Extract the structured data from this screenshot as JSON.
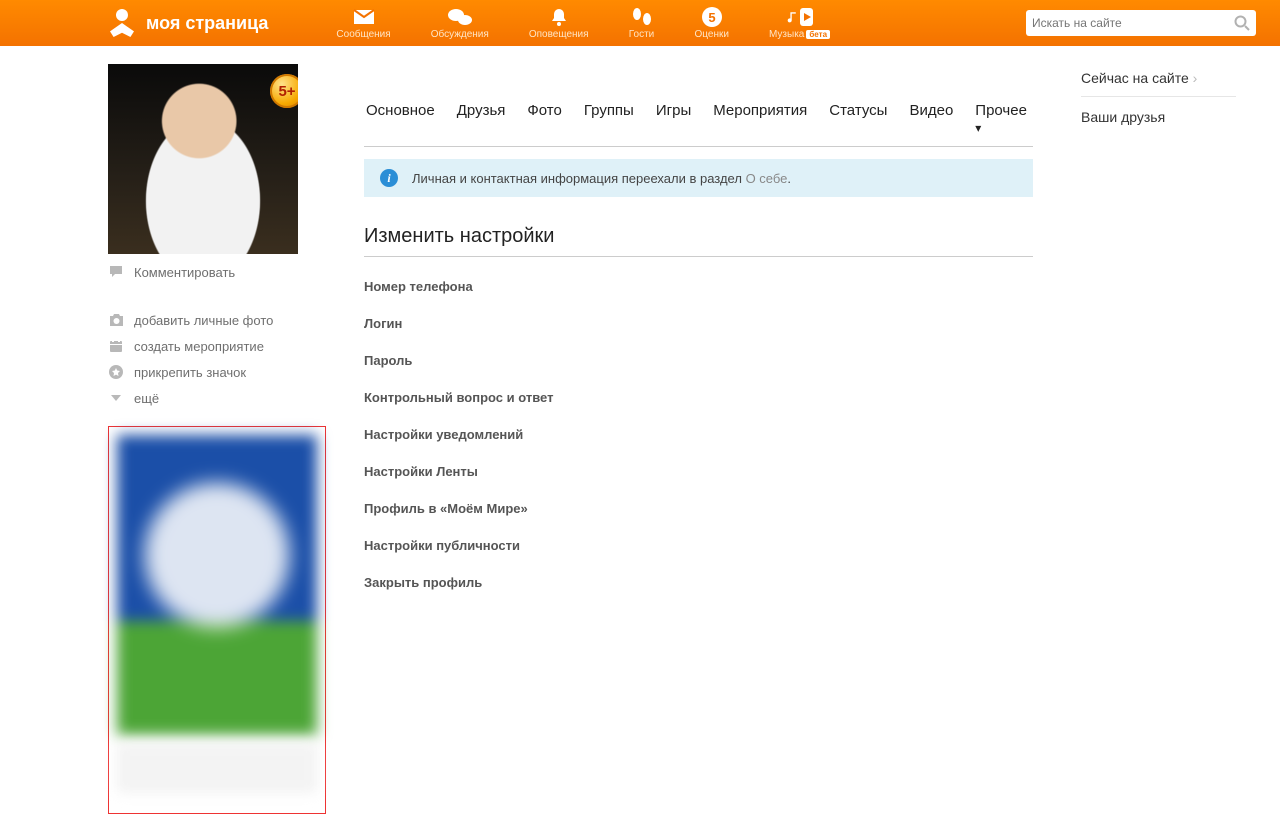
{
  "header": {
    "brand": "моя страница",
    "nav": [
      {
        "id": "messages",
        "label": "Сообщения"
      },
      {
        "id": "discussions",
        "label": "Обсуждения"
      },
      {
        "id": "notifications",
        "label": "Оповещения"
      },
      {
        "id": "guests",
        "label": "Гости"
      },
      {
        "id": "marks",
        "label": "Оценки"
      },
      {
        "id": "music",
        "label": "Музыка",
        "beta": "бета"
      }
    ],
    "search_placeholder": "Искать на сайте"
  },
  "left": {
    "badge": "5+",
    "comment": "Комментировать",
    "actions": [
      {
        "id": "add-photo",
        "label": "добавить личные фото"
      },
      {
        "id": "create-event",
        "label": "создать мероприятие"
      },
      {
        "id": "attach-badge",
        "label": "прикрепить значок"
      },
      {
        "id": "more",
        "label": "ещё"
      }
    ]
  },
  "tabs": [
    {
      "id": "main",
      "label": "Основное"
    },
    {
      "id": "friends",
      "label": "Друзья"
    },
    {
      "id": "photo",
      "label": "Фото"
    },
    {
      "id": "groups",
      "label": "Группы"
    },
    {
      "id": "games",
      "label": "Игры"
    },
    {
      "id": "events",
      "label": "Мероприятия"
    },
    {
      "id": "statuses",
      "label": "Статусы"
    },
    {
      "id": "video",
      "label": "Видео"
    },
    {
      "id": "more",
      "label": "Прочее"
    }
  ],
  "info": {
    "text": "Личная и контактная информация переехали в раздел ",
    "link": "О себе",
    "punct": "."
  },
  "settings": {
    "title": "Изменить настройки",
    "items": [
      "Номер телефона",
      "Логин",
      "Пароль",
      "Контрольный вопрос и ответ",
      "Настройки уведомлений",
      "Настройки Ленты",
      "Профиль в «Моём Мире»",
      "Настройки публичности",
      "Закрыть профиль"
    ]
  },
  "right": {
    "online": "Сейчас на сайте",
    "chev": "›",
    "friends": "Ваши друзья"
  }
}
